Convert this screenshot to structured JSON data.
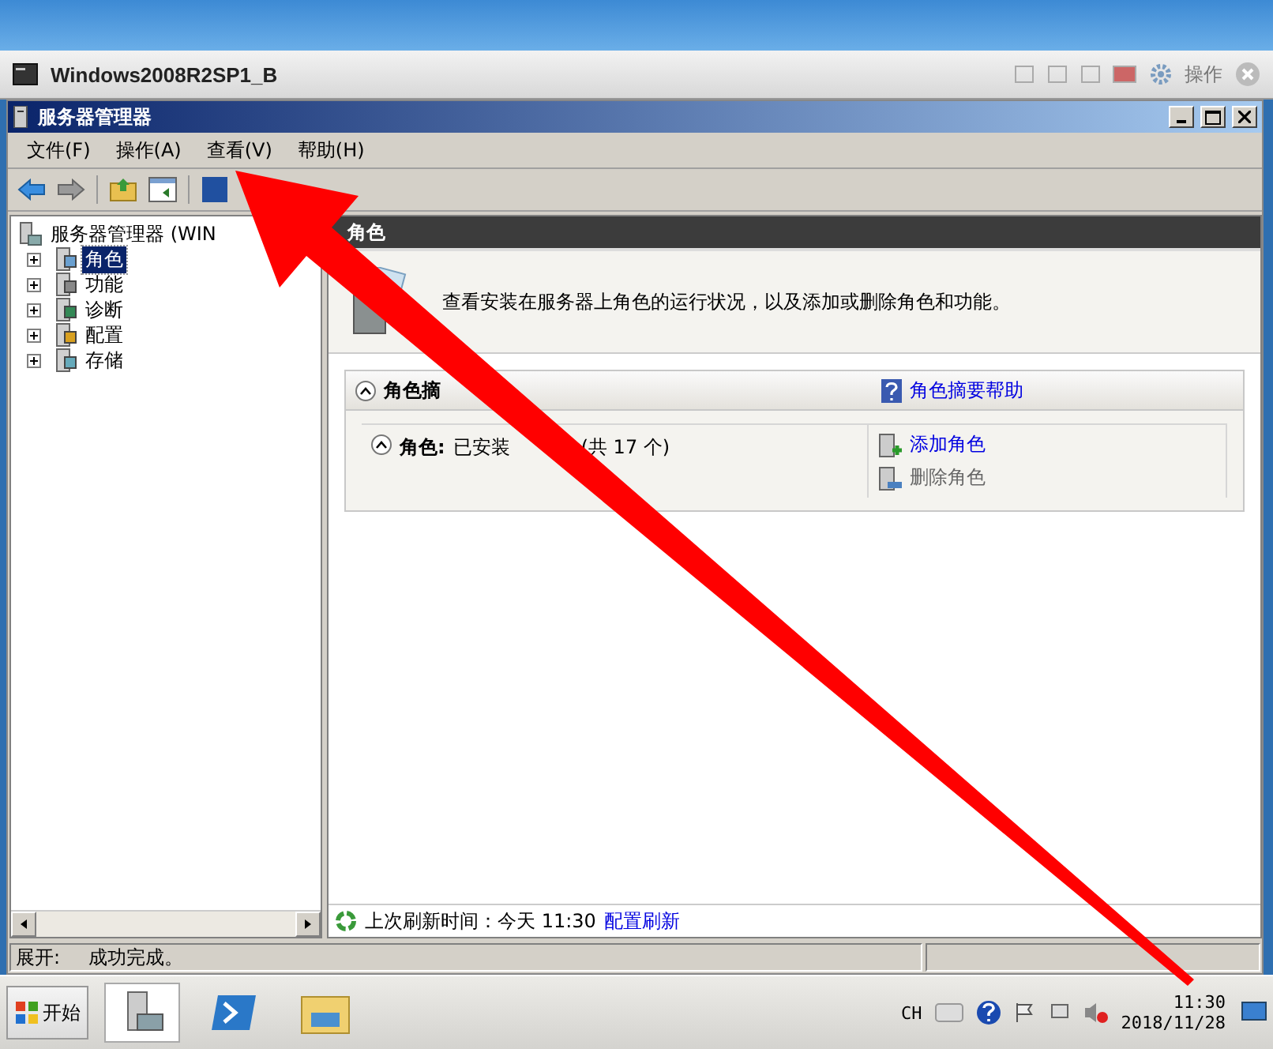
{
  "vm_window": {
    "title": "Windows2008R2SP1_B",
    "action": "操作"
  },
  "app_window": {
    "title": "服务器管理器"
  },
  "menu": [
    "文件(F)",
    "操作(A)",
    "查看(V)",
    "帮助(H)"
  ],
  "tree": {
    "label": "服务器管理器 (WIN",
    "children": [
      {
        "label": "角色",
        "selected": true,
        "expanded": false
      },
      {
        "label": "功能",
        "selected": false,
        "expanded": false
      },
      {
        "label": "诊断",
        "selected": false,
        "expanded": false
      },
      {
        "label": "配置",
        "selected": false,
        "expanded": false
      },
      {
        "label": "存储",
        "selected": false,
        "expanded": false
      }
    ]
  },
  "content": {
    "header": "角色",
    "description": "查看安装在服务器上角色的运行状况，以及添加或删除角色和功能。",
    "summary": {
      "title": "角色摘",
      "help_link": "角色摘要帮助",
      "expanded": true,
      "roles": {
        "label": "角色:",
        "installed": "已安装",
        "count": "(共 17 个)",
        "expanded": true
      },
      "actions": [
        {
          "label": "添加角色",
          "disabled": false
        },
        {
          "label": "删除角色",
          "disabled": true
        }
      ]
    },
    "refresh": {
      "text": "上次刷新时间：今天 11:30",
      "link": "配置刷新"
    }
  },
  "status_bar": {
    "label": "展开:",
    "message": "成功完成。"
  },
  "taskbar": {
    "start": "开始",
    "language": "CH",
    "time": "11:30",
    "date": "2018/11/28"
  }
}
